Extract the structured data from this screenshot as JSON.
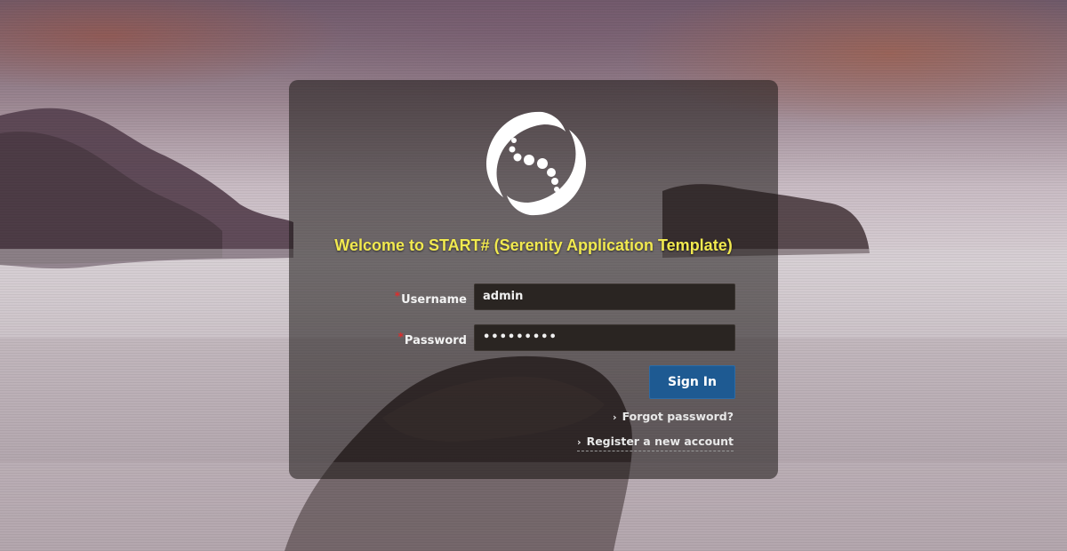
{
  "login": {
    "welcome_text": "Welcome to START# (Serenity Application Template)",
    "username_label": "Username",
    "username_value": "admin",
    "password_label": "Password",
    "password_value": "•••••••••",
    "required_marker": "*",
    "signin_label": "Sign In",
    "forgot_password_label": "Forgot password?",
    "register_label": "Register a new account",
    "link_chevron": "›"
  },
  "colors": {
    "welcome_text": "#f1e94f",
    "signin_button": "#1e5a92",
    "required_marker": "#e02b2b",
    "panel": "rgba(25,22,20,0.55)"
  },
  "icons": {
    "logo": "serenity-swirl-logo-icon",
    "link_bullet": "chevron-right-icon"
  }
}
